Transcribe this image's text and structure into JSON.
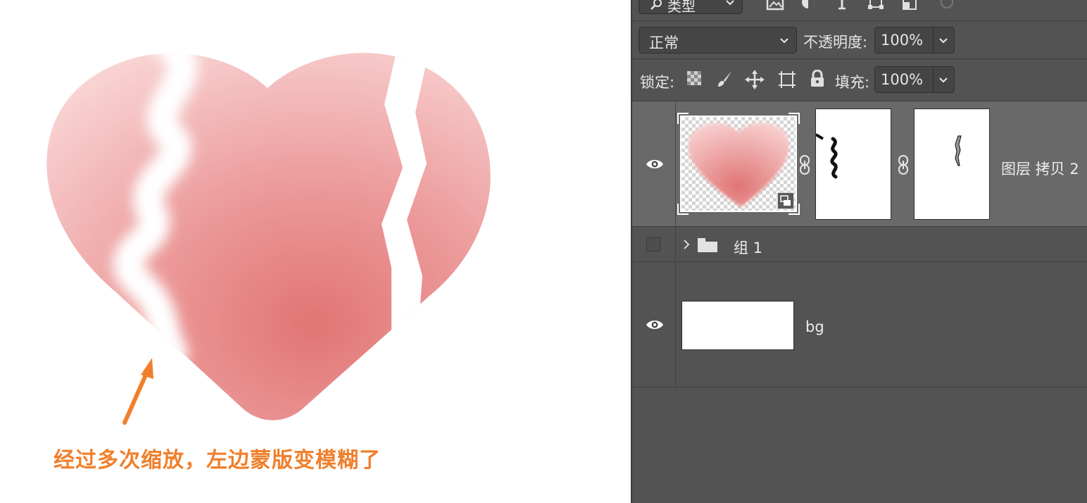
{
  "canvas": {
    "annotation_text": "经过多次缩放，左边蒙版变模糊了"
  },
  "layers_panel": {
    "filter": {
      "kind_label": "类型",
      "icons": [
        "image-filter-icon",
        "adjustment-filter-icon",
        "type-filter-icon",
        "shape-filter-icon",
        "smart-object-filter-icon"
      ]
    },
    "blend_mode": "正常",
    "opacity_label": "不透明度:",
    "opacity_value": "100%",
    "lock_label": "锁定:",
    "lock_icons": [
      "lock-transparent-pixels-icon",
      "lock-image-pixels-icon",
      "lock-position-icon",
      "lock-artboard-icon",
      "lock-all-icon"
    ],
    "fill_label": "填充:",
    "fill_value": "100%",
    "layers": [
      {
        "name": "图层 拷贝 2",
        "visible": true,
        "selected": true,
        "type": "smart-object-with-masks"
      },
      {
        "name": "组 1",
        "visible": false,
        "selected": false,
        "type": "group"
      },
      {
        "name": "bg",
        "visible": true,
        "selected": false,
        "type": "pixel"
      }
    ]
  },
  "colors": {
    "annotation": "#f07f2b",
    "panel_bg": "#535353",
    "selected_layer_bg": "#696969",
    "heart_light": "#f8cfcf",
    "heart_dark": "#e07575"
  }
}
